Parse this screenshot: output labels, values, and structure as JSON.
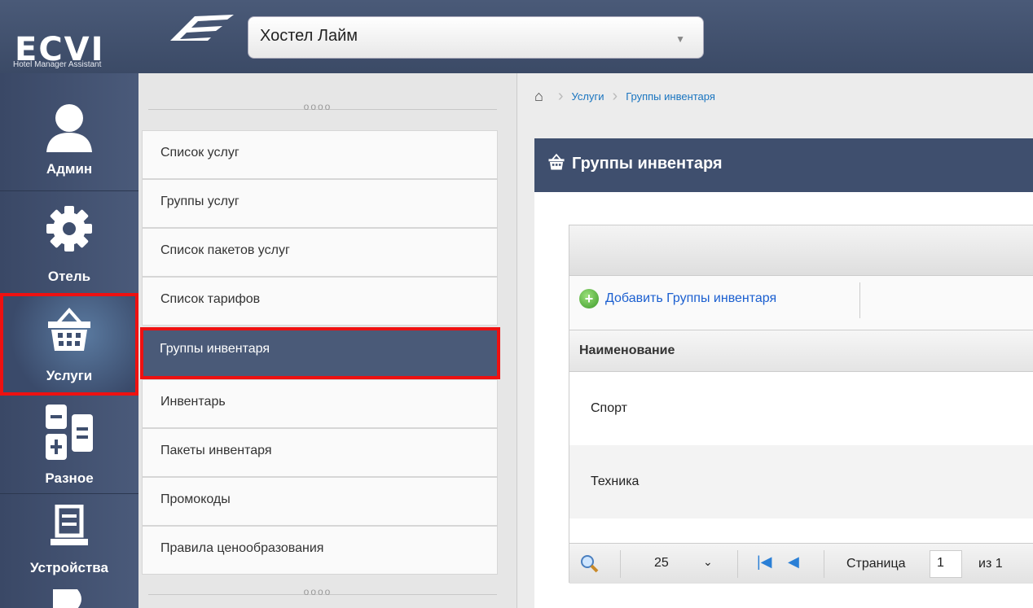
{
  "header": {
    "logo_text": "ECVI",
    "logo_subtitle": "Hotel Manager Assistant",
    "hotel_selected": "Хостел Лайм"
  },
  "sidebar": {
    "items": [
      {
        "label": "Админ",
        "icon": "user-icon"
      },
      {
        "label": "Отель",
        "icon": "gear-icon"
      },
      {
        "label": "Услуги",
        "icon": "basket-icon"
      },
      {
        "label": "Разное",
        "icon": "calculator-icon"
      },
      {
        "label": "Устройства",
        "icon": "document-icon"
      }
    ],
    "active": "Услуги"
  },
  "submenu": {
    "grip": "oooo",
    "items": [
      {
        "label": "Список услуг"
      },
      {
        "label": "Группы услуг"
      },
      {
        "label": "Список пакетов услуг"
      },
      {
        "label": "Список тарифов"
      },
      {
        "label": "Группы инвентаря"
      },
      {
        "label": "Инвентарь"
      },
      {
        "label": "Пакеты инвентаря"
      },
      {
        "label": "Промокоды"
      },
      {
        "label": "Правила ценообразования"
      }
    ],
    "active": "Группы инвентаря"
  },
  "breadcrumb": {
    "items": [
      "Услуги",
      "Группы инвентаря"
    ]
  },
  "panel": {
    "title": "Группы инвентаря"
  },
  "grid": {
    "add_label": "Добавить Группы инвентаря",
    "column_header": "Наименование",
    "rows": [
      "Спорт",
      "Техника"
    ],
    "pager": {
      "page_size": "25",
      "page_label": "Страница",
      "page_value": "1",
      "of_label": "из 1"
    }
  },
  "colors": {
    "header_bg": "#3f4f6e",
    "highlight": "#e11111",
    "link": "#1b5fd0"
  }
}
